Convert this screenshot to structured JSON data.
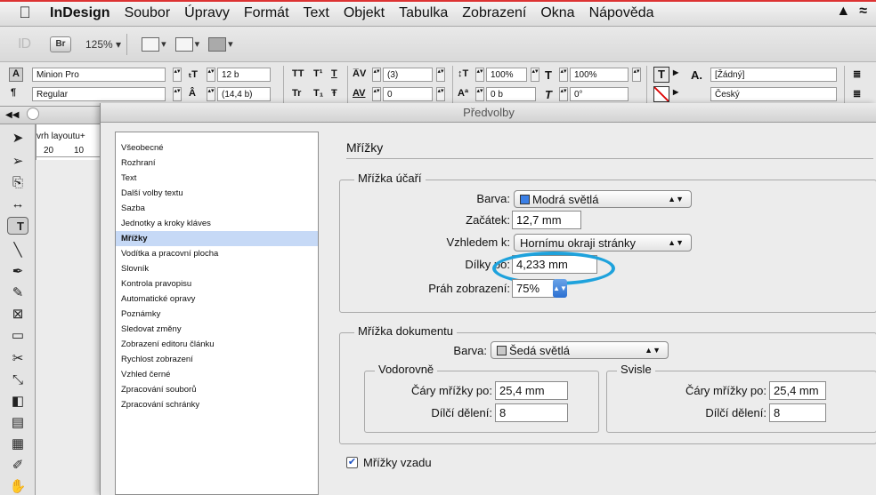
{
  "menubar": {
    "app": "InDesign",
    "items": [
      "Soubor",
      "Úpravy",
      "Formát",
      "Text",
      "Objekt",
      "Tabulka",
      "Zobrazení",
      "Okna",
      "Nápověda"
    ]
  },
  "appbar": {
    "logo": "ID",
    "bridge": "Br",
    "zoom": "125% ▾"
  },
  "control": {
    "font_family": "Minion Pro",
    "font_style": "Regular",
    "font_size": "12 b",
    "leading": "(14,4 b)",
    "kerning": "(3)",
    "tracking": "0",
    "vscale": "100%",
    "hscale": "100%",
    "baseline": "0 b",
    "skew": "0°",
    "char_style": "[Žádný]",
    "language": "Český",
    "tt1": "TT",
    "tt2": "T¹",
    "tt3": "T",
    "tt4": "Tr",
    "tt5": "T₁",
    "tt6": "Ŧ"
  },
  "doc": {
    "tab_label": "vrh layoutu+",
    "ruler1": "20",
    "ruler2": "10"
  },
  "dialog": {
    "title": "Předvolby",
    "categories": [
      "Všeobecné",
      "Rozhraní",
      "Text",
      "Další volby textu",
      "Sazba",
      "Jednotky a kroky kláves",
      "Mřížky",
      "Vodítka a pracovní plocha",
      "Slovník",
      "Kontrola pravopisu",
      "Automatické opravy",
      "Poznámky",
      "Sledovat změny",
      "Zobrazení editoru článku",
      "Rychlost zobrazení",
      "Vzhled černé",
      "Zpracování souborů",
      "Zpracování schránky"
    ],
    "active_category": "Mřížky",
    "section_title": "Mřížky",
    "baseline": {
      "title": "Mřížka účaří",
      "color_label": "Barva:",
      "color_value": "Modrá světlá",
      "color_swatch": "#3a7fe6",
      "start_label": "Začátek:",
      "start_value": "12,7 mm",
      "relative_label": "Vzhledem k:",
      "relative_value": "Hornímu okraji stránky",
      "increment_label": "Dílky po:",
      "increment_value": "4,233 mm",
      "threshold_label": "Práh zobrazení:",
      "threshold_value": "75%"
    },
    "document": {
      "title": "Mřížka dokumentu",
      "color_label": "Barva:",
      "color_value": "Šedá světlá",
      "color_swatch": "#c8c8c8",
      "horizontal": {
        "title": "Vodorovně",
        "lines_label": "Čáry mřížky po:",
        "lines_value": "25,4 mm",
        "sub_label": "Dílčí dělení:",
        "sub_value": "8"
      },
      "vertical": {
        "title": "Svisle",
        "lines_label": "Čáry mřížky po:",
        "lines_value": "25,4 mm",
        "sub_label": "Dílčí dělení:",
        "sub_value": "8"
      }
    },
    "grids_back_label": "Mřížky vzadu",
    "grids_back_checked": true,
    "highlight_color": "#1ea2dc"
  }
}
